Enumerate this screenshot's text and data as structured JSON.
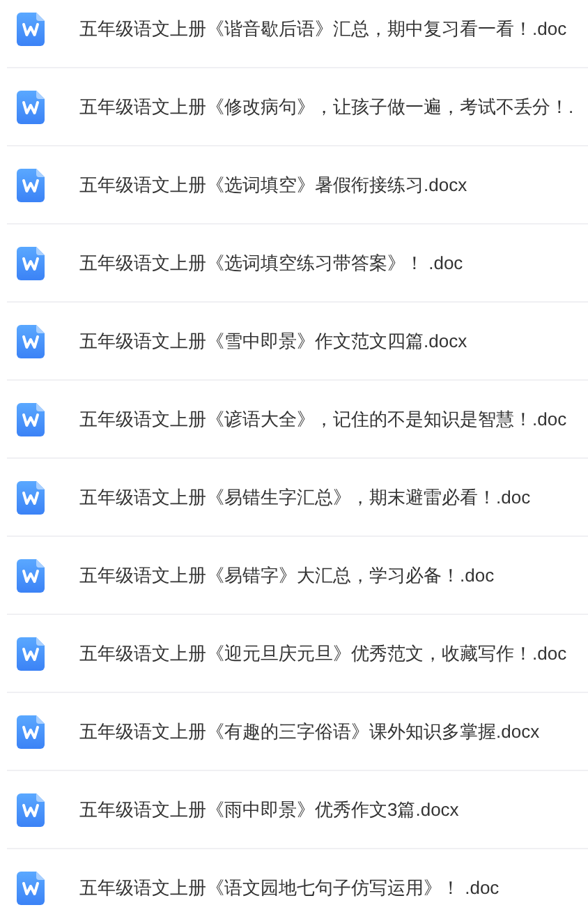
{
  "files": [
    {
      "name": "五年级语文上册《谐音歇后语》汇总，期中复习看一看！.doc"
    },
    {
      "name": "五年级语文上册《修改病句》，让孩子做一遍，考试不丢分！."
    },
    {
      "name": "五年级语文上册《选词填空》暑假衔接练习.docx"
    },
    {
      "name": "五年级语文上册《选词填空练习带答案》！ .doc"
    },
    {
      "name": "五年级语文上册《雪中即景》作文范文四篇.docx"
    },
    {
      "name": "五年级语文上册《谚语大全》，记住的不是知识是智慧！.doc"
    },
    {
      "name": "五年级语文上册《易错生字汇总》，期末避雷必看！.doc"
    },
    {
      "name": "五年级语文上册《易错字》大汇总，学习必备！.doc"
    },
    {
      "name": "五年级语文上册《迎元旦庆元旦》优秀范文，收藏写作！.doc"
    },
    {
      "name": "五年级语文上册《有趣的三字俗语》课外知识多掌握.docx"
    },
    {
      "name": "五年级语文上册《雨中即景》优秀作文3篇.docx"
    },
    {
      "name": "五年级语文上册《语文园地七句子仿写运用》！ .doc"
    }
  ]
}
